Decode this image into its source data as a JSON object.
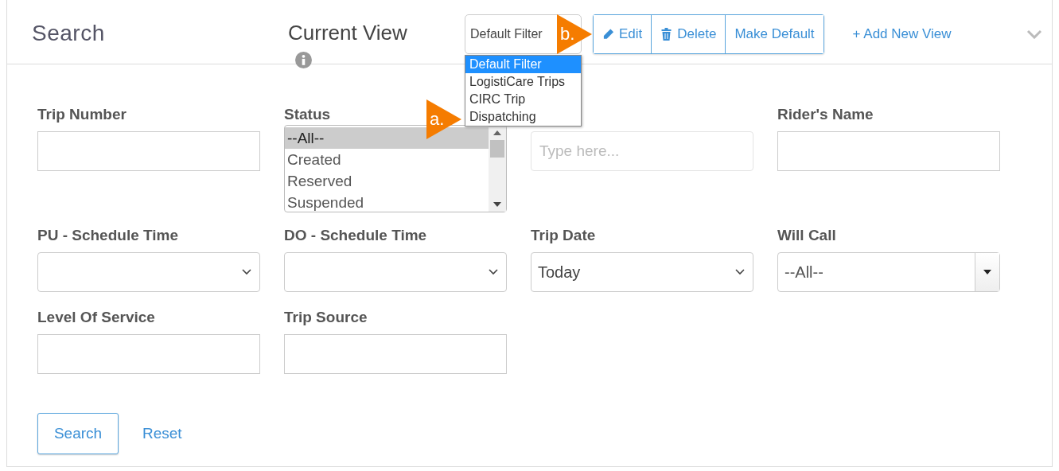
{
  "header": {
    "title": "Search",
    "current_view_label": "Current View",
    "view_select": {
      "value": "Default Filter",
      "expanded": true,
      "options": [
        {
          "label": "Default Filter",
          "selected": true
        },
        {
          "label": "LogistiCare Trips",
          "selected": false
        },
        {
          "label": "CIRC Trip",
          "selected": false
        },
        {
          "label": "Dispatching",
          "selected": false
        }
      ]
    },
    "buttons": [
      {
        "label": "Edit"
      },
      {
        "label": "Delete"
      },
      {
        "label": "Make Default"
      }
    ],
    "add_link": "+ Add New View"
  },
  "fields": [
    {
      "kind": "text",
      "label": "Trip Number"
    },
    {
      "kind": "listbox",
      "label": "Status",
      "options": [
        {
          "label": "--All--",
          "selected": true
        },
        {
          "label": "Created",
          "selected": false
        },
        {
          "label": "Reserved",
          "selected": false
        },
        {
          "label": "Suspended",
          "selected": false
        }
      ]
    },
    {
      "kind": "text",
      "placeholder": "Type here..."
    },
    {
      "kind": "text",
      "label": "Rider's Name"
    },
    {
      "kind": "select",
      "label": "PU - Schedule Time"
    },
    {
      "kind": "select",
      "label": "DO - Schedule Time"
    },
    {
      "kind": "select",
      "label": "Trip Date",
      "value": "Today"
    },
    {
      "kind": "combo",
      "label": "Will Call",
      "value": "--All--"
    },
    {
      "kind": "text",
      "label": "Level Of Service"
    },
    {
      "kind": "text",
      "label": "Trip Source"
    }
  ],
  "actions": [
    {
      "label": "Search",
      "kind": "primary"
    },
    {
      "label": "Reset",
      "kind": "link"
    }
  ],
  "annotations": [
    {
      "label": "a."
    },
    {
      "label": "b."
    }
  ]
}
